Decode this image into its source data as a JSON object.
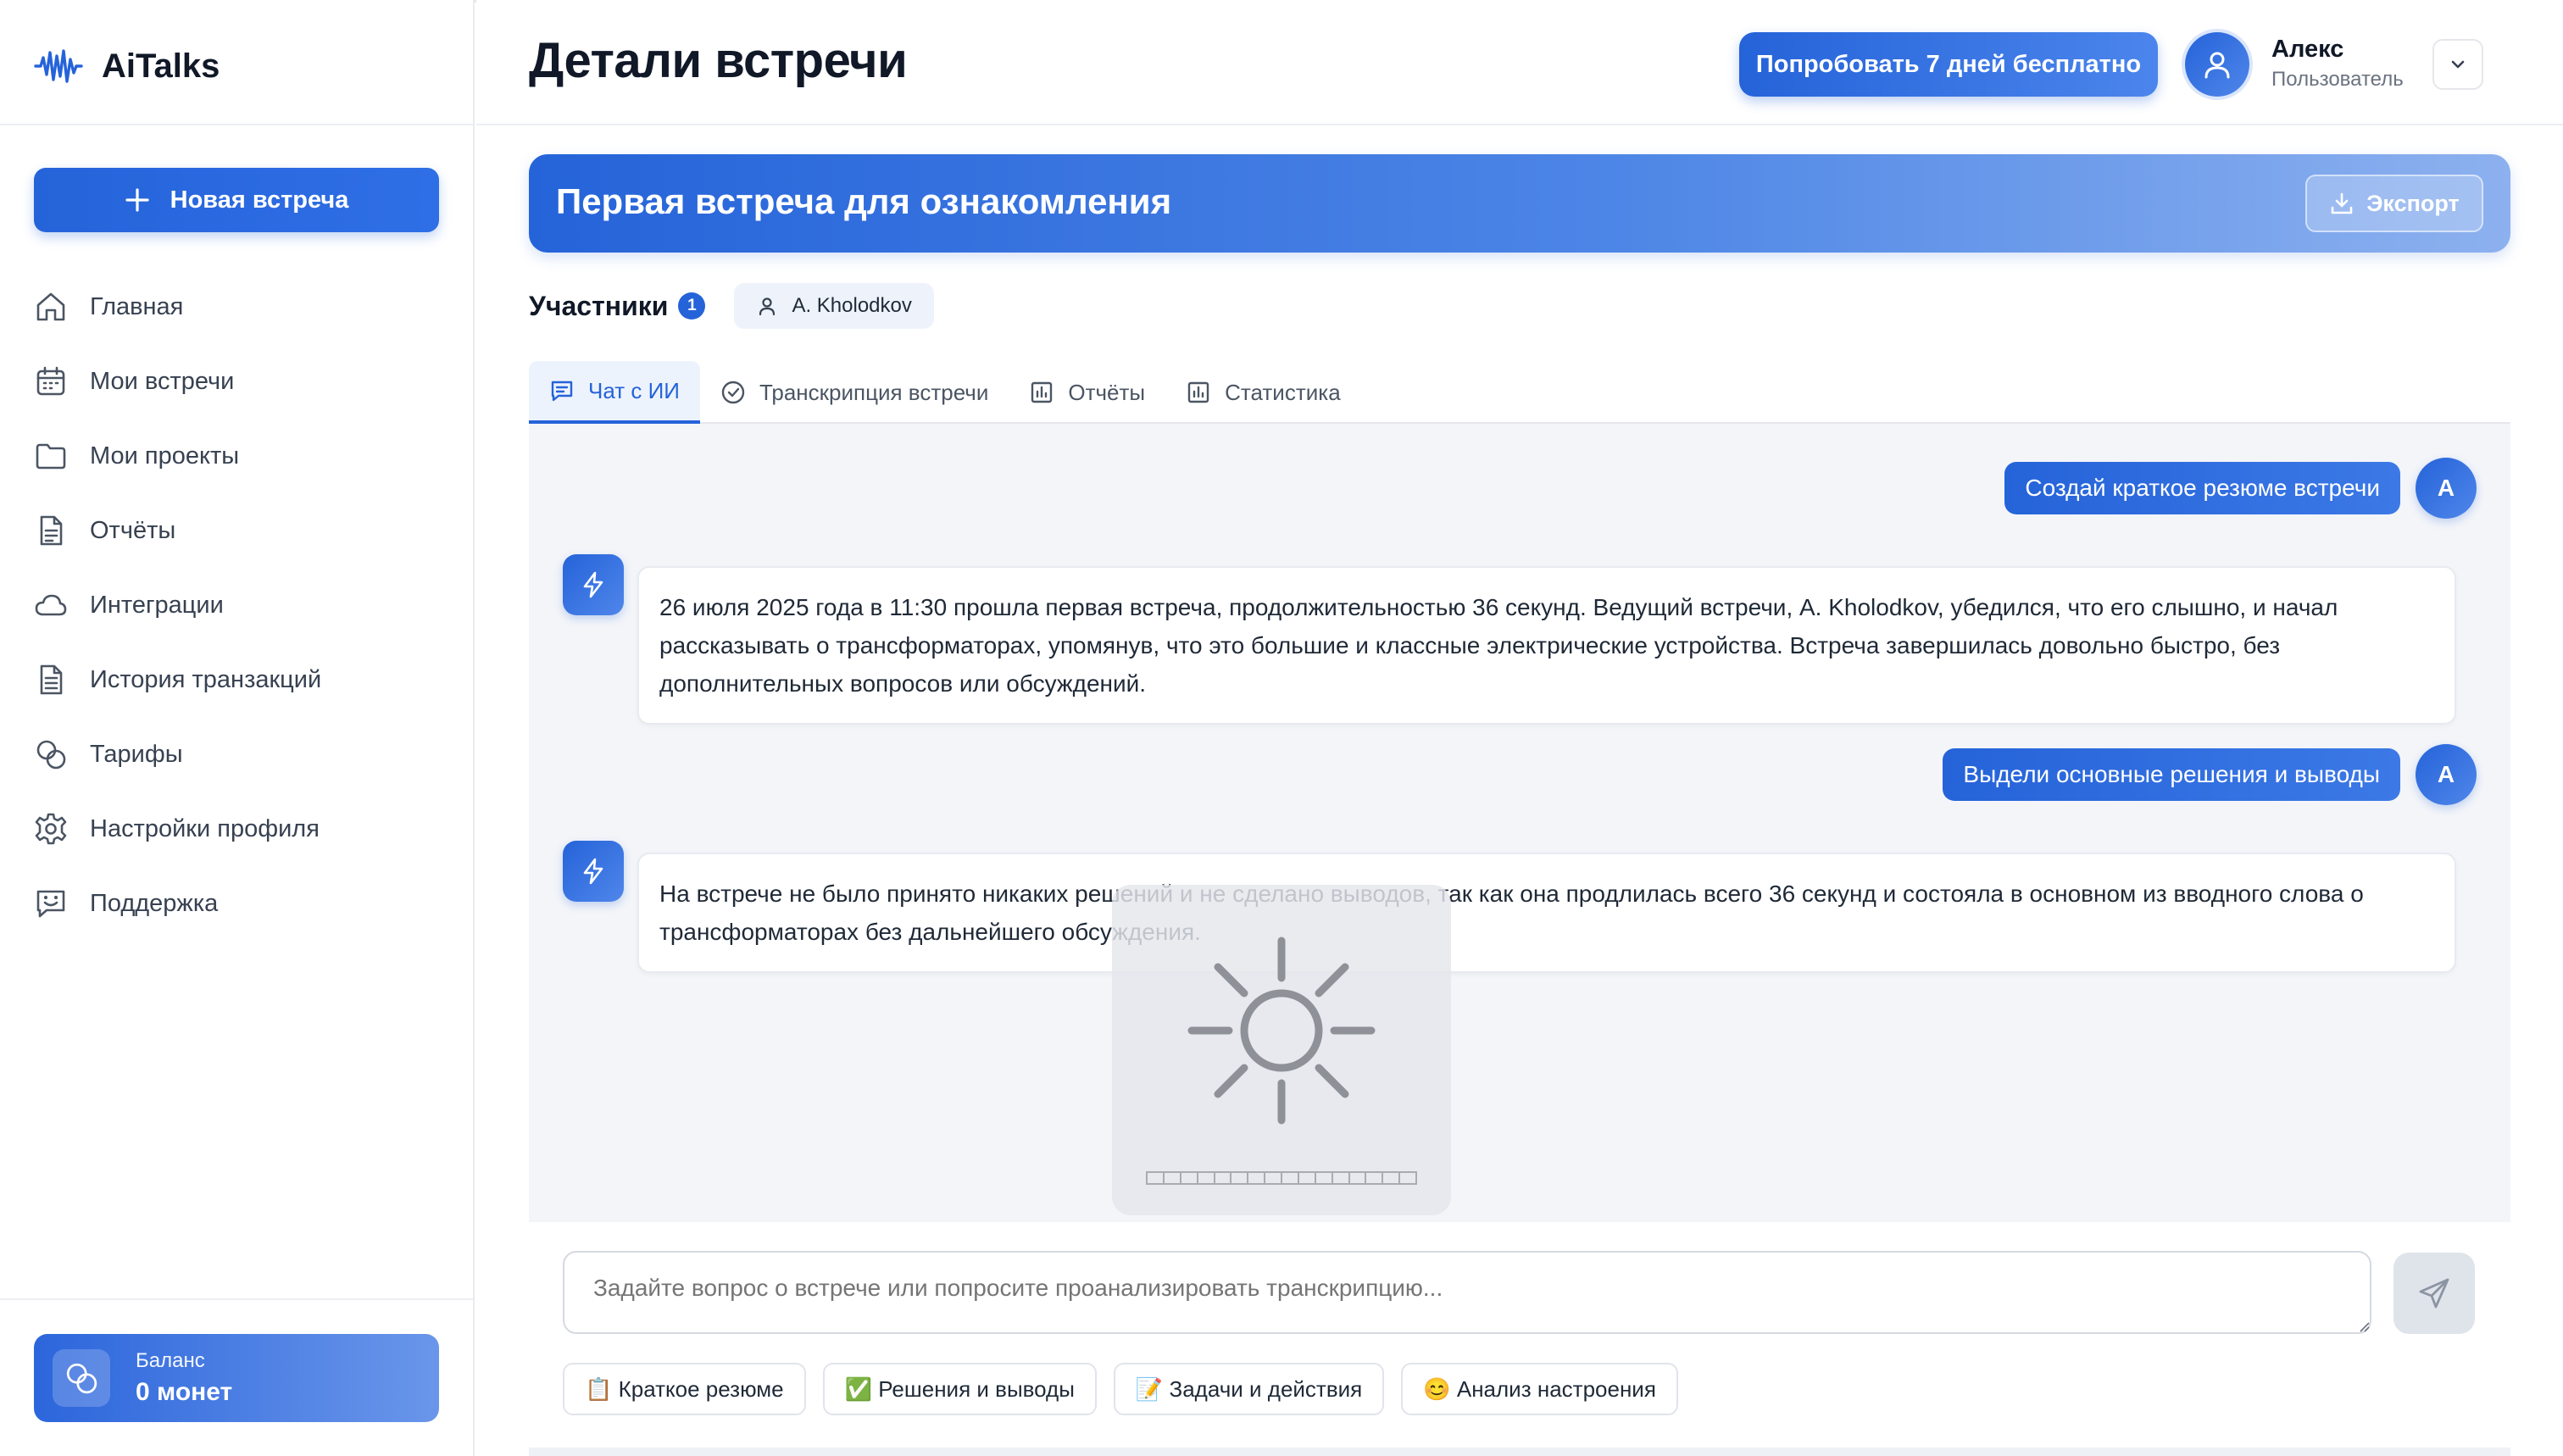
{
  "app": {
    "name": "AiTalks"
  },
  "sidebar": {
    "new_meeting_label": "Новая встреча",
    "items": [
      {
        "label": "Главная",
        "icon": "home-icon"
      },
      {
        "label": "Мои встречи",
        "icon": "calendar-icon"
      },
      {
        "label": "Мои проекты",
        "icon": "folder-icon"
      },
      {
        "label": "Отчёты",
        "icon": "document-icon"
      },
      {
        "label": "Интеграции",
        "icon": "cloud-icon"
      },
      {
        "label": "История транзакций",
        "icon": "receipt-icon"
      },
      {
        "label": "Тарифы",
        "icon": "coins-icon"
      },
      {
        "label": "Настройки профиля",
        "icon": "gear-icon"
      },
      {
        "label": "Поддержка",
        "icon": "chat-smile-icon"
      }
    ],
    "balance": {
      "label": "Баланс",
      "value": "0 монет"
    }
  },
  "header": {
    "title": "Детали встречи",
    "trial_label": "Попробовать 7 дней бесплатно",
    "user": {
      "name": "Алекс",
      "role": "Пользователь"
    }
  },
  "meeting": {
    "title": "Первая встреча для ознакомления",
    "export_label": "Экспорт",
    "participants_label": "Участники",
    "participants_count": "1",
    "participants": [
      "A. Kholodkov"
    ]
  },
  "tabs": [
    {
      "label": "Чат с ИИ",
      "icon": "chat-icon",
      "active": true
    },
    {
      "label": "Транскрипция встречи",
      "icon": "check-circle-icon",
      "active": false
    },
    {
      "label": "Отчёты",
      "icon": "bar-chart-icon",
      "active": false
    },
    {
      "label": "Статистика",
      "icon": "bar-chart-icon",
      "active": false
    }
  ],
  "chat": {
    "user_initial": "A",
    "messages": [
      {
        "role": "user",
        "text": "Создай краткое резюме встречи"
      },
      {
        "role": "ai",
        "text": "26 июля 2025 года в 11:30 прошла первая встреча, продолжительностью 36 секунд. Ведущий встречи, A. Kholodkov, убедился, что его слышно, и начал рассказывать о трансформаторах, упомянув, что это большие и классные электрические устройства. Встреча завершилась довольно быстро, без дополнительных вопросов или обсуждений."
      },
      {
        "role": "user",
        "text": "Выдели основные решения и выводы"
      },
      {
        "role": "ai",
        "text": "На встрече не было принято никаких решений и не сделано выводов, так как она продлилась всего 36 секунд и состояла в основном из вводного слова о трансформаторах без дальнейшего обсуждения."
      }
    ]
  },
  "composer": {
    "placeholder": "Задайте вопрос о встрече или попросите проанализировать транскрипцию...",
    "quick_actions": [
      "📋 Краткое резюме",
      "✅ Решения и выводы",
      "📝 Задачи и действия",
      "😊 Анализ настроения"
    ]
  },
  "colors": {
    "accent": "#2563d9",
    "background": "#ffffff",
    "chat_bg": "#f3f5f9"
  }
}
